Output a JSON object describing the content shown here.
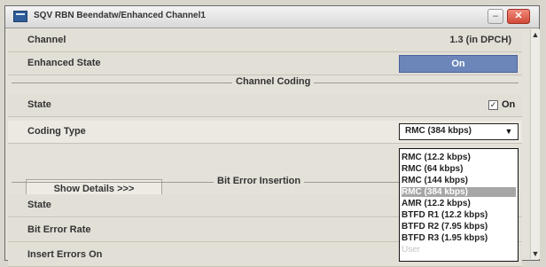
{
  "window": {
    "title": "SQV RBN Beendatw/Enhanced Channel1"
  },
  "rows": {
    "channel": {
      "label": "Channel",
      "value": "1.3 (in DPCH)"
    },
    "enhanced_state": {
      "label": "Enhanced State",
      "button_label": "On"
    },
    "channel_coding": {
      "title": "Channel Coding",
      "state_label": "State",
      "state_checkbox_label": "On",
      "coding_type_label": "Coding Type",
      "coding_type_value": "RMC (384 kbps)",
      "show_details_label": "Show Details >>>"
    },
    "bit_error_insertion": {
      "title": "Bit Error Insertion",
      "state_label": "State",
      "bit_error_rate_label": "Bit Error Rate",
      "insert_errors_on_label": "Insert Errors On"
    }
  },
  "dropdown": {
    "items": [
      "RMC (12.2 kbps)",
      "RMC (64 kbps)",
      "RMC (144 kbps)",
      "RMC (384 kbps)",
      "AMR (12.2 kbps)",
      "BTFD R1 (12.2 kbps)",
      "BTFD R2 (7.95 kbps)",
      "BTFD R3 (1.95 kbps)",
      "User"
    ]
  },
  "icons": {
    "minimize": "minimize-icon",
    "close": "close-icon",
    "app": "app-icon",
    "dropdown_arrow": "chevron-down-icon",
    "scroll_up": "scroll-up-icon",
    "scroll_down": "scroll-down-icon"
  },
  "colors": {
    "on_button": "#6d86ba",
    "selected_item": "#a6a6a6"
  }
}
